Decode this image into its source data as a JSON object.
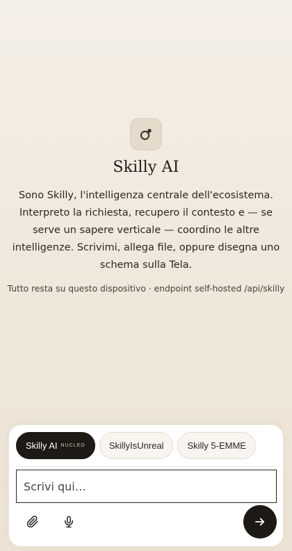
{
  "hero": {
    "title": "Skilly AI",
    "logo_icon": "ring-dot-icon",
    "intro": "Sono Skilly, l'intelligenza centrale dell'ecosistema. Interpreto la richiesta, recupero il contesto e — se serve un sapere verticale — coordino le altre intelligenze. Scrivimi, allega file, oppure disegna uno schema sulla Tela.",
    "footnote": "Tutto resta su questo dispositivo · endpoint self-hosted /api/skilly"
  },
  "composer": {
    "modes": [
      {
        "label": "Skilly AI",
        "badge": "NUCLEO",
        "active": true
      },
      {
        "label": "SkillyIsUnreal",
        "active": false
      },
      {
        "label": "Skilly 5-EMME",
        "active": false
      }
    ],
    "input_placeholder": "Scrivi qui…",
    "input_value": "",
    "attach_icon": "paperclip-icon",
    "mic_icon": "microphone-icon",
    "send_icon": "arrow-right-icon"
  },
  "colors": {
    "background": "#f1eadf",
    "accent_dark": "#1d1915",
    "tile": "#e6dbcb"
  }
}
